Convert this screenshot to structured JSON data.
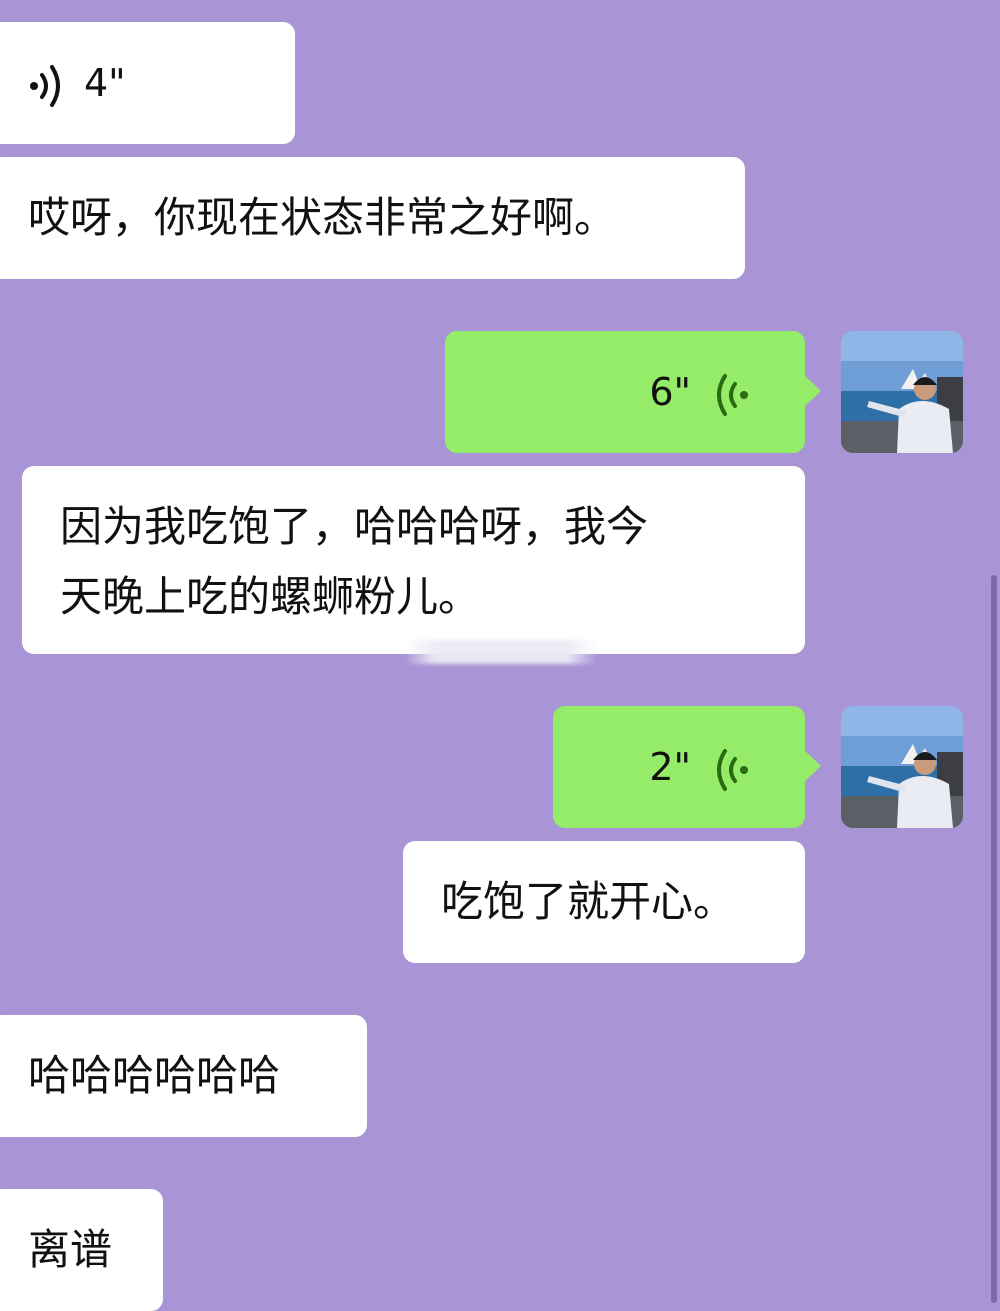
{
  "messages": {
    "m1": {
      "duration": "4\""
    },
    "m2": {
      "text": "哎呀，你现在状态非常之好啊。"
    },
    "m3": {
      "duration": "6\""
    },
    "m4": {
      "line1": "因为我吃饱了，哈哈哈呀，我今",
      "line2": "天晚上吃的螺蛳粉儿。"
    },
    "m5": {
      "duration": "2\""
    },
    "m6": {
      "text": "吃饱了就开心。"
    },
    "m7": {
      "text": "哈哈哈哈哈哈"
    },
    "m8": {
      "text": "离谱"
    }
  },
  "colors": {
    "background": "#a994d6",
    "incoming_bubble": "#ffffff",
    "outgoing_bubble": "#95ec69",
    "voice_icon_out": "#2a6a12"
  },
  "icons": {
    "voice_in": "voice-wave-icon",
    "voice_out": "voice-wave-icon"
  }
}
